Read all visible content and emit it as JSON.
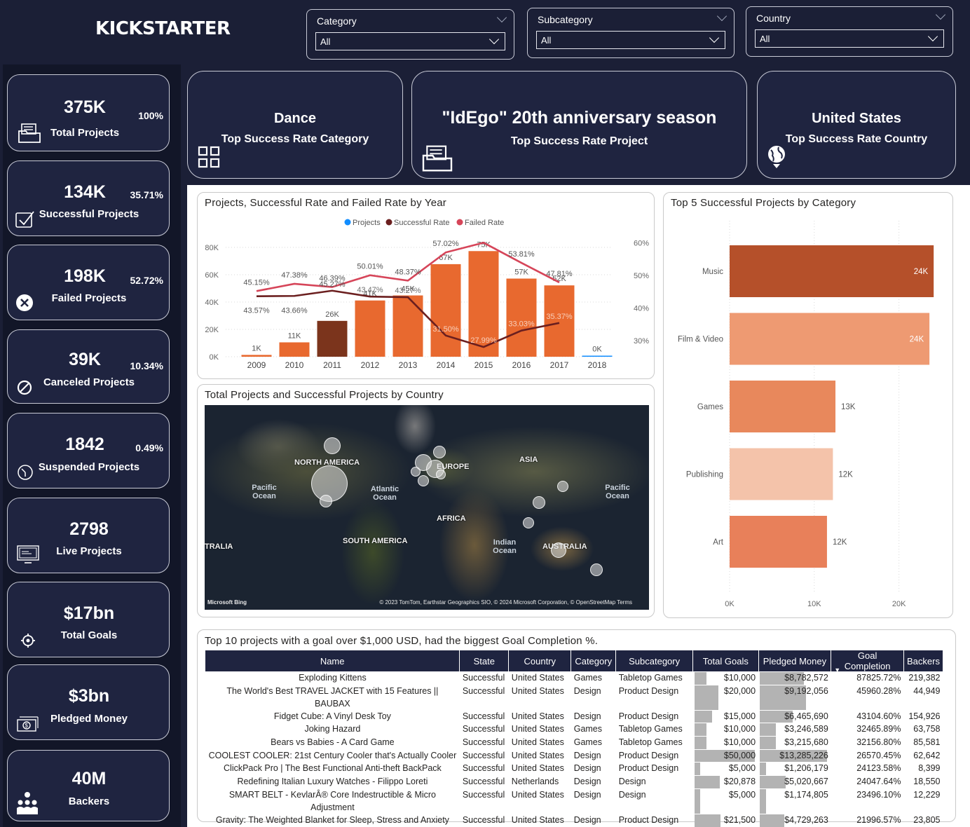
{
  "app": {
    "logo": "KICKSTARTER"
  },
  "filters": [
    {
      "label": "Category",
      "value": "All"
    },
    {
      "label": "Subcategory",
      "value": "All"
    },
    {
      "label": "Country",
      "value": "All"
    }
  ],
  "kpis": [
    {
      "value": "375K",
      "label": "Total Projects",
      "pct": "100%",
      "icon": "folder-icon"
    },
    {
      "value": "134K",
      "label": "Successful Projects",
      "pct": "35.71%",
      "icon": "checkbox-icon"
    },
    {
      "value": "198K",
      "label": "Failed Projects",
      "pct": "52.72%",
      "icon": "x-circle-icon"
    },
    {
      "value": "39K",
      "label": "Canceled Projects",
      "pct": "10.34%",
      "icon": "ban-icon"
    },
    {
      "value": "1842",
      "label": "Suspended Projects",
      "pct": "0.49%",
      "icon": "timer-icon"
    },
    {
      "value": "2798",
      "label": "Live Projects",
      "pct": "",
      "icon": "monitor-icon"
    },
    {
      "value": "$17bn",
      "label": "Total Goals",
      "pct": "",
      "icon": "target-icon"
    },
    {
      "value": "$3bn",
      "label": "Pledged Money",
      "pct": "",
      "icon": "money-icon"
    },
    {
      "value": "40M",
      "label": "Backers",
      "pct": "",
      "icon": "people-icon"
    }
  ],
  "top_cards": [
    {
      "value": "Dance",
      "label": "Top Success Rate Category",
      "icon": "grid-icon"
    },
    {
      "value": "\"IdEgo\" 20th anniversary season",
      "label": "Top Success Rate Project",
      "icon": "folder-icon"
    },
    {
      "value": "United States",
      "label": "Top Success Rate Country",
      "icon": "globe-icon"
    }
  ],
  "year_chart": {
    "title": "Projects, Successful Rate and Failed Rate by Year",
    "legend": [
      "Projects",
      "Successful Rate",
      "Failed Rate"
    ],
    "colors": {
      "projects": "#e8692f",
      "projects_highlight": "#7b341c",
      "successful": "#6b1f1f",
      "failed": "#d64559"
    }
  },
  "chart_data": [
    {
      "type": "bar",
      "title": "Projects, Successful Rate and Failed Rate by Year",
      "categories": [
        "2009",
        "2010",
        "2011",
        "2012",
        "2013",
        "2014",
        "2015",
        "2016",
        "2017",
        "2018"
      ],
      "y_ticks": [
        "0K",
        "20K",
        "40K",
        "60K",
        "80K"
      ],
      "y2_ticks": [
        "30%",
        "40%",
        "50%",
        "60%"
      ],
      "ylim": [
        0,
        80000
      ],
      "y2lim": [
        25,
        62
      ],
      "series": [
        {
          "name": "Projects",
          "kind": "bar",
          "values": [
            1329,
            10519,
            26237,
            41165,
            44851,
            67745,
            77300,
            57184,
            52200,
            124
          ],
          "labels": [
            "1K",
            "11K",
            "26K",
            "41K",
            "45K",
            "67K",
            "75K",
            "57K",
            "52K",
            "0K"
          ]
        },
        {
          "name": "Successful Rate",
          "kind": "line",
          "values": [
            43.57,
            43.66,
            45.27,
            43.47,
            43.27,
            31.5,
            27.99,
            33.03,
            35.37,
            null
          ],
          "labels": [
            "43.57%",
            "43.66%",
            "45.27%",
            "43.47%",
            "43.27%",
            "31.50%",
            "27.99%",
            "33.03%",
            "35.37%",
            ""
          ]
        },
        {
          "name": "Failed Rate",
          "kind": "line",
          "values": [
            45.15,
            47.38,
            46.39,
            50.01,
            48.37,
            57.02,
            60.0,
            53.81,
            47.81,
            null
          ],
          "labels": [
            "45.15%",
            "47.38%",
            "46.39%",
            "50.01%",
            "48.37%",
            "57.02%",
            "",
            "53.81%",
            "47.81%",
            ""
          ]
        }
      ]
    },
    {
      "type": "bar",
      "orientation": "horizontal",
      "title": "Top 5 Successful Projects by Category",
      "categories": [
        "Music",
        "Film & Video",
        "Games",
        "Publishing",
        "Art"
      ],
      "values": [
        24100,
        23600,
        12500,
        12200,
        11500
      ],
      "labels": [
        "24K",
        "24K",
        "13K",
        "12K",
        "12K"
      ],
      "colors": [
        "#b5502a",
        "#ee9a72",
        "#e8885c",
        "#f4c3aa",
        "#e8805a"
      ],
      "x_ticks": [
        "0K",
        "10K",
        "20K"
      ],
      "xlim": [
        0,
        24500
      ]
    }
  ],
  "map": {
    "title": "Total Projects and Successful Projects by Country",
    "labels": [
      "NORTH AMERICA",
      "EUROPE",
      "ASIA",
      "AFRICA",
      "SOUTH AMERICA",
      "AUSTRALIA",
      "TRALIA"
    ],
    "oceans": [
      "Pacific Ocean",
      "Atlantic Ocean",
      "Indian Ocean",
      "Pacific Ocean"
    ],
    "brand": "Microsoft Bing",
    "attribution": "© 2023 TomTom, Earthstar Geographics SIO, © 2024 Microsoft Corporation, © OpenStreetMap  Terms"
  },
  "table": {
    "title": "Top 10 projects with a goal over $1,000 USD, had the biggest Goal Completion %.",
    "columns": [
      "Name",
      "State",
      "Country",
      "Category",
      "Subcategory",
      "Total Goals",
      "Pledged Money",
      "Goal Completion",
      "Backers"
    ],
    "rows": [
      {
        "name": "Exploding Kittens",
        "state": "Successful",
        "country": "United States",
        "category": "Games",
        "subcategory": "Tabletop Games",
        "goal": "$10,000",
        "goal_frac": 0.2,
        "pledged": "$8,782,572",
        "pledged_frac": 0.66,
        "completion": "87825.72%",
        "backers": "219,382"
      },
      {
        "name": "The World's Best TRAVEL JACKET with 15 Features || BAUBAX",
        "state": "Successful",
        "country": "United States",
        "category": "Design",
        "subcategory": "Product Design",
        "goal": "$20,000",
        "goal_frac": 0.4,
        "pledged": "$9,192,056",
        "pledged_frac": 0.69,
        "completion": "45960.28%",
        "backers": "44,949"
      },
      {
        "name": "Fidget Cube: A Vinyl Desk Toy",
        "state": "Successful",
        "country": "United States",
        "category": "Design",
        "subcategory": "Product Design",
        "goal": "$15,000",
        "goal_frac": 0.3,
        "pledged": "$6,465,690",
        "pledged_frac": 0.49,
        "completion": "43104.60%",
        "backers": "154,926"
      },
      {
        "name": "Joking Hazard",
        "state": "Successful",
        "country": "United States",
        "category": "Games",
        "subcategory": "Tabletop Games",
        "goal": "$10,000",
        "goal_frac": 0.2,
        "pledged": "$3,246,589",
        "pledged_frac": 0.24,
        "completion": "32465.89%",
        "backers": "63,758"
      },
      {
        "name": "Bears vs Babies - A Card Game",
        "state": "Successful",
        "country": "United States",
        "category": "Games",
        "subcategory": "Tabletop Games",
        "goal": "$10,000",
        "goal_frac": 0.2,
        "pledged": "$3,215,680",
        "pledged_frac": 0.24,
        "completion": "32156.80%",
        "backers": "85,581"
      },
      {
        "name": "COOLEST COOLER: 21st Century Cooler that's Actually Cooler",
        "state": "Successful",
        "country": "United States",
        "category": "Design",
        "subcategory": "Product Design",
        "goal": "$50,000",
        "goal_frac": 1.0,
        "pledged": "$13,285,226",
        "pledged_frac": 1.0,
        "completion": "26570.45%",
        "backers": "62,642"
      },
      {
        "name": "ClickPack Pro | The Best Functional Anti-theft BackPack",
        "state": "Successful",
        "country": "United States",
        "category": "Design",
        "subcategory": "Product Design",
        "goal": "$5,000",
        "goal_frac": 0.1,
        "pledged": "$1,206,179",
        "pledged_frac": 0.09,
        "completion": "24123.58%",
        "backers": "8,399"
      },
      {
        "name": "Redefining Italian Luxury Watches - Filippo Loreti",
        "state": "Successful",
        "country": "Netherlands",
        "category": "Design",
        "subcategory": "Design",
        "goal": "$20,878",
        "goal_frac": 0.42,
        "pledged": "$5,020,667",
        "pledged_frac": 0.38,
        "completion": "24047.64%",
        "backers": "18,550"
      },
      {
        "name": "SMART BELT - KevlarÂ® Core Indestructible & Micro Adjustment",
        "state": "Successful",
        "country": "United States",
        "category": "Design",
        "subcategory": "Design",
        "goal": "$5,000",
        "goal_frac": 0.1,
        "pledged": "$1,174,805",
        "pledged_frac": 0.09,
        "completion": "23496.10%",
        "backers": "12,229"
      },
      {
        "name": "Gravity: The Weighted Blanket for Sleep, Stress and Anxiety",
        "state": "Successful",
        "country": "United States",
        "category": "Design",
        "subcategory": "Product Design",
        "goal": "$21,500",
        "goal_frac": 0.43,
        "pledged": "$4,729,263",
        "pledged_frac": 0.36,
        "completion": "21996.57%",
        "backers": "23,805"
      }
    ]
  }
}
